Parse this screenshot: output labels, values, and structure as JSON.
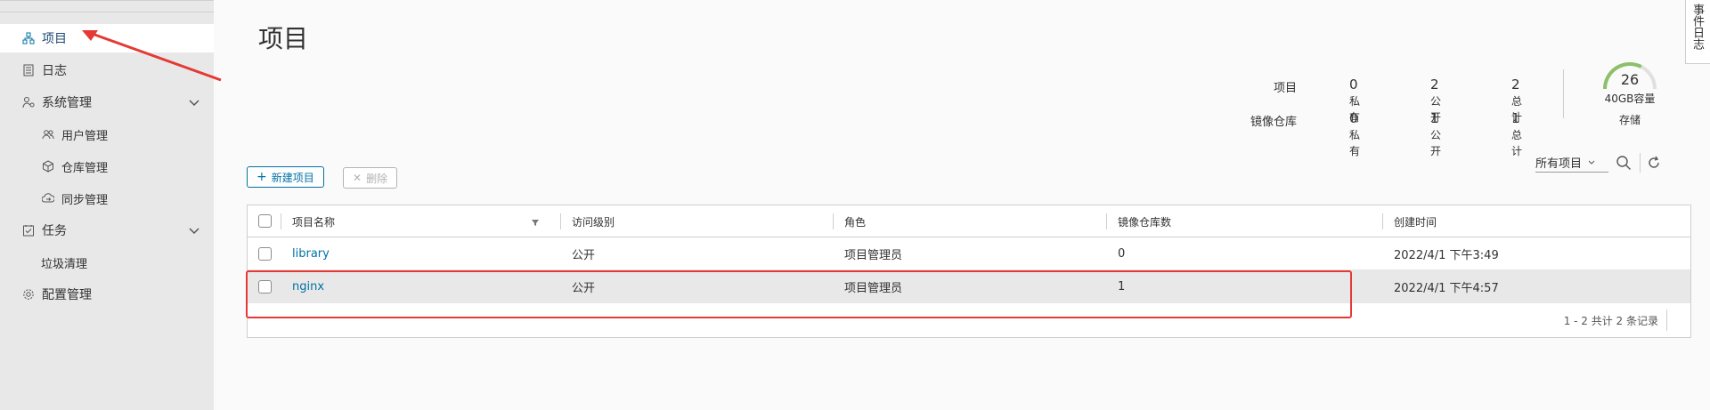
{
  "sidebar": {
    "items": [
      {
        "label": "项目",
        "icon": "projects-icon",
        "active": true
      },
      {
        "label": "日志",
        "icon": "logs-icon"
      },
      {
        "label": "系统管理",
        "icon": "system-admin-icon",
        "expandable": true
      },
      {
        "label": "用户管理",
        "icon": "users-icon",
        "sub": true
      },
      {
        "label": "仓库管理",
        "icon": "registries-icon",
        "sub": true
      },
      {
        "label": "同步管理",
        "icon": "replication-icon",
        "sub": true
      },
      {
        "label": "任务",
        "icon": "tasks-icon",
        "expandable": true
      },
      {
        "label": "垃圾清理",
        "sub": true
      },
      {
        "label": "配置管理",
        "icon": "gear-icon"
      }
    ]
  },
  "page": {
    "title": "项目"
  },
  "side_tab": {
    "label": "事件日志"
  },
  "stats": {
    "projects": {
      "label": "项目",
      "private": "0",
      "public": "2",
      "total": "2"
    },
    "repos": {
      "label": "镜像仓库",
      "private": "0",
      "public": "1",
      "total": "1"
    },
    "suffix_private": "私有",
    "suffix_public": "公开",
    "suffix_total": "总计"
  },
  "storage": {
    "value": "26",
    "capacity": "40GB容量",
    "label": "存储",
    "fraction": 0.65
  },
  "toolbar": {
    "new_label": "新建项目",
    "delete_label": "删除",
    "filter_label": "所有项目"
  },
  "table": {
    "columns": [
      "项目名称",
      "访问级别",
      "角色",
      "镜像仓库数",
      "创建时间"
    ],
    "rows": [
      {
        "name": "library",
        "access": "公开",
        "role": "项目管理员",
        "repos": "0",
        "created": "2022/4/1 下午3:49"
      },
      {
        "name": "nginx",
        "access": "公开",
        "role": "项目管理员",
        "repos": "1",
        "created": "2022/4/1 下午4:57"
      }
    ],
    "footer": "1 - 2 共计 2 条记录"
  },
  "colors": {
    "accent": "#0072a3",
    "annotation": "#e53935",
    "gauge": "#8cc06b"
  }
}
